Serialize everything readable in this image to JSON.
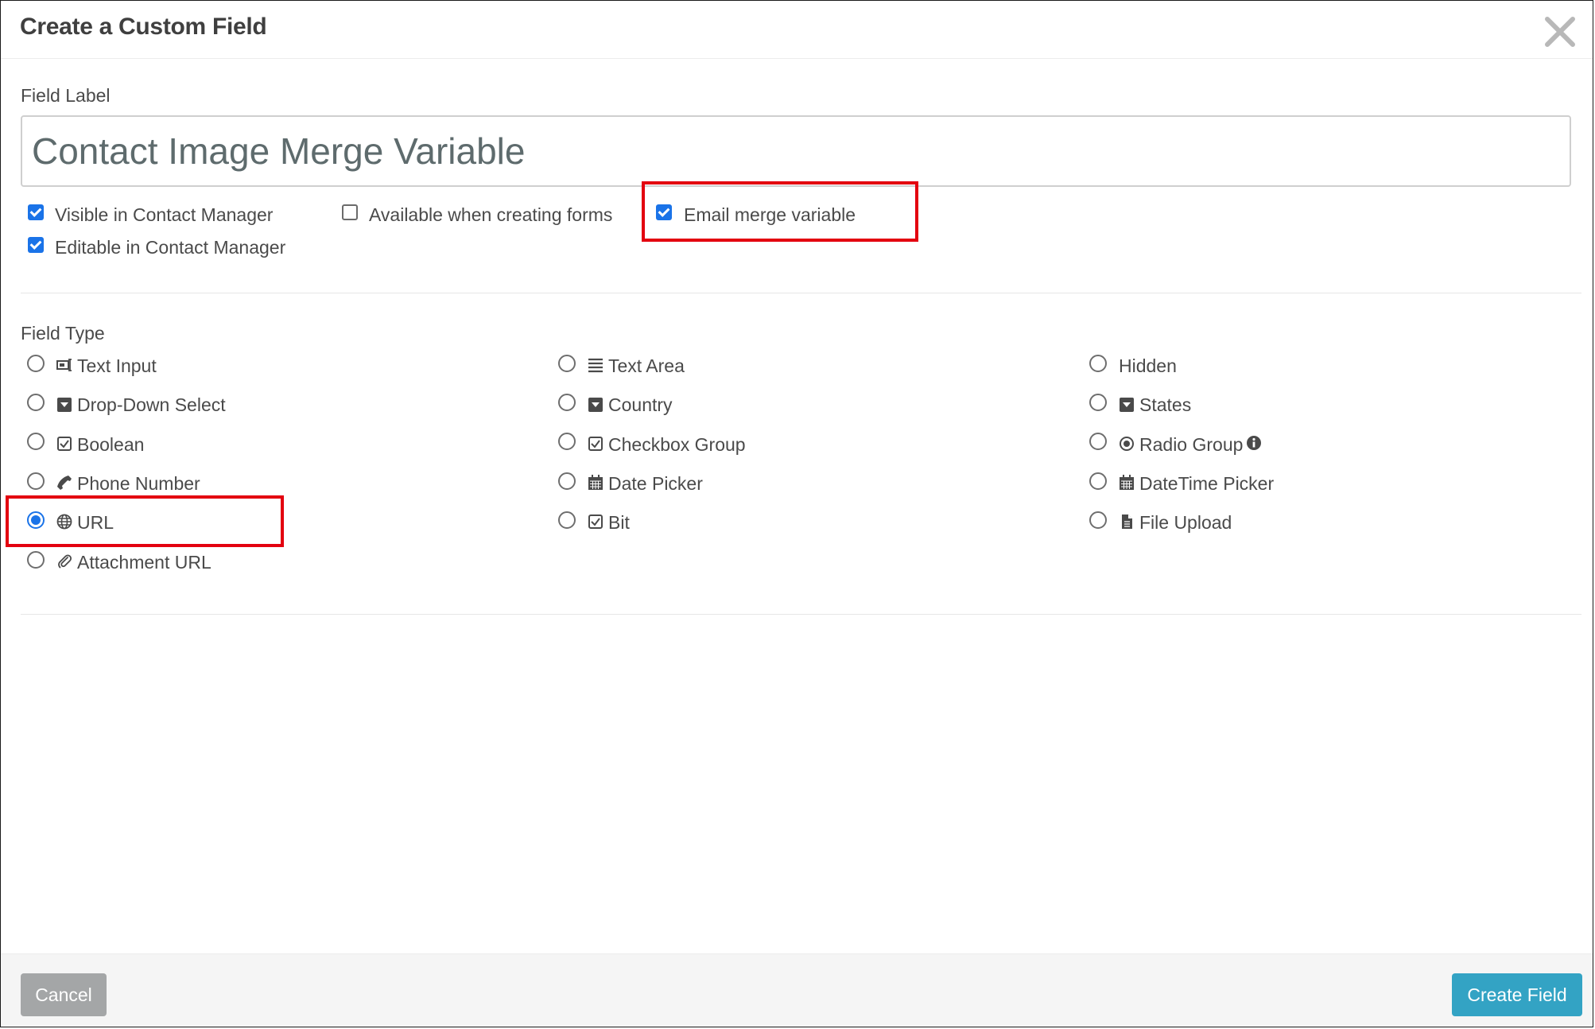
{
  "dialog": {
    "title": "Create a Custom Field",
    "close_icon": "close-icon"
  },
  "field_label": {
    "label": "Field Label",
    "value": "Contact Image Merge Variable"
  },
  "options": [
    {
      "label": "Visible in Contact Manager",
      "checked": true
    },
    {
      "label": "Editable in Contact Manager",
      "checked": true
    },
    {
      "label": "Available when creating forms",
      "checked": false
    },
    {
      "label": "Email merge variable",
      "checked": true,
      "highlighted": true
    }
  ],
  "field_type": {
    "label": "Field Type",
    "selected": "URL",
    "types": [
      {
        "label": "Text Input",
        "icon": "text-input-icon"
      },
      {
        "label": "Drop-Down Select",
        "icon": "dropdown-icon"
      },
      {
        "label": "Boolean",
        "icon": "checkbox-icon"
      },
      {
        "label": "Phone Number",
        "icon": "phone-icon"
      },
      {
        "label": "URL",
        "icon": "globe-icon"
      },
      {
        "label": "Attachment URL",
        "icon": "paperclip-icon"
      },
      {
        "label": "Text Area",
        "icon": "lines-icon"
      },
      {
        "label": "Country",
        "icon": "dropdown-icon"
      },
      {
        "label": "Checkbox Group",
        "icon": "checkbox-icon"
      },
      {
        "label": "Date Picker",
        "icon": "calendar-icon"
      },
      {
        "label": "Bit",
        "icon": "checkbox-icon"
      },
      {
        "label": "Hidden",
        "icon": ""
      },
      {
        "label": "States",
        "icon": "dropdown-icon"
      },
      {
        "label": "Radio Group",
        "icon": "radio-dot-icon"
      },
      {
        "label": "DateTime Picker",
        "icon": "calendar-icon"
      },
      {
        "label": "File Upload",
        "icon": "file-icon"
      }
    ]
  },
  "footer": {
    "cancel_label": "Cancel",
    "create_label": "Create Field"
  },
  "colors": {
    "checkbox_blue": "#1a73e8",
    "highlight_red": "#e3000f",
    "create_button": "#33a3c4",
    "cancel_button": "#a4a6a7"
  }
}
